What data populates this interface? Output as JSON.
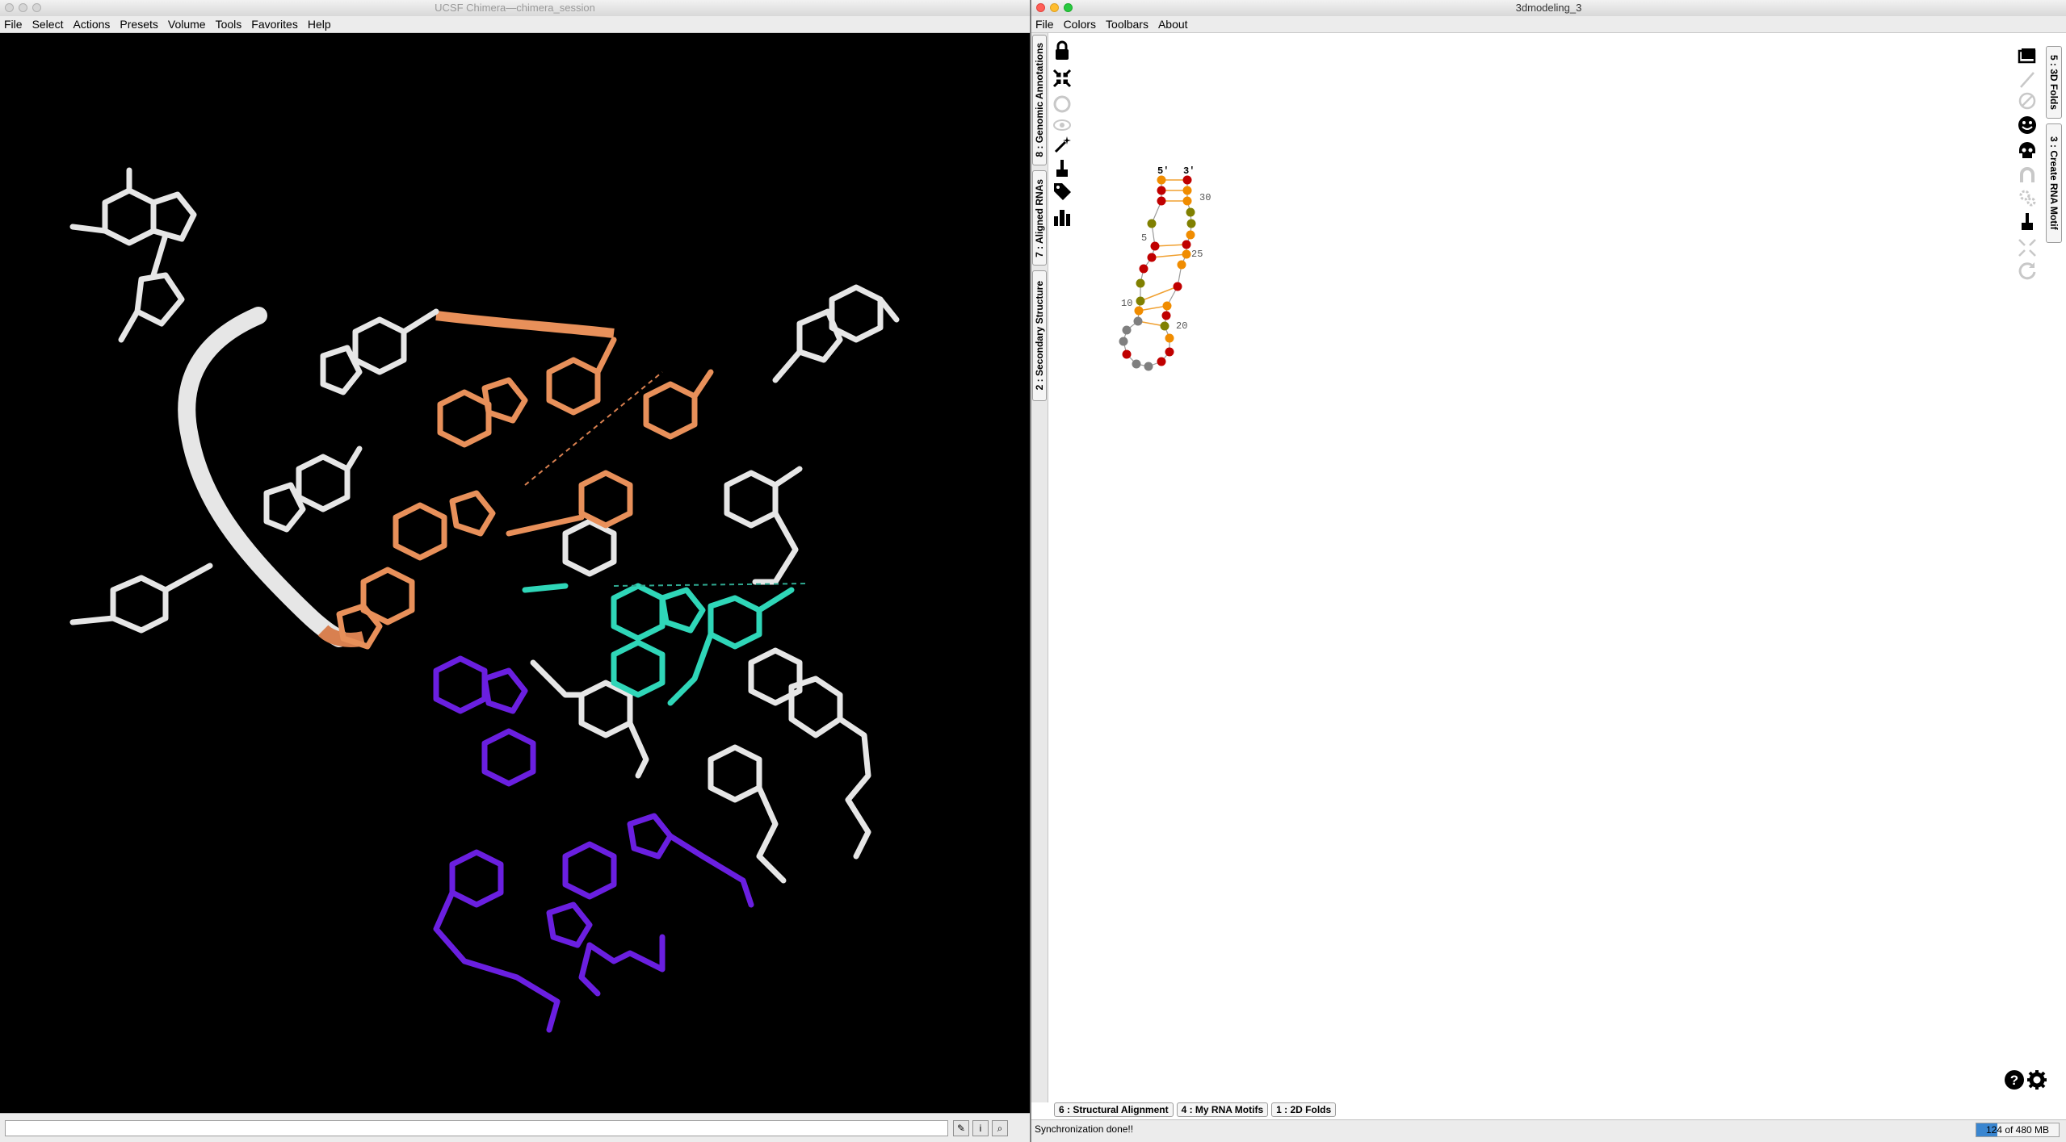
{
  "chimera": {
    "title": "UCSF Chimera—chimera_session",
    "menu": [
      "File",
      "Select",
      "Actions",
      "Presets",
      "Volume",
      "Tools",
      "Favorites",
      "Help"
    ],
    "command_line": {
      "value": ""
    },
    "bottom_buttons": [
      {
        "name": "draw-icon",
        "glyph": "✎"
      },
      {
        "name": "info-icon",
        "glyph": "i"
      },
      {
        "name": "magnifier-icon",
        "glyph": "⌕"
      }
    ]
  },
  "modeler": {
    "title": "3dmodeling_3",
    "menu": [
      "File",
      "Colors",
      "Toolbars",
      "About"
    ],
    "left_tabs": [
      "8 : Genomic Annotations",
      "7 : Aligned RNAs",
      "2 : Secondary Structure"
    ],
    "right_tabs": [
      "5 : 3D Folds",
      "3 : Create RNA Motif"
    ],
    "bottom_tabs": [
      "6 : Structural Alignment",
      "4 : My RNA Motifs",
      "1 : 2D Folds"
    ],
    "status": "Synchronization done!!",
    "memory": {
      "label": "124 of 480 MB used",
      "used_fraction": 0.258
    },
    "colors": {
      "red": "#c00000",
      "orange": "#f08c00",
      "olive": "#808000",
      "gray": "#7f7f7f",
      "pair": "#f0a030"
    },
    "structure": {
      "five_prime": "5'",
      "three_prime": "3'",
      "numbers": [
        "5",
        "10",
        "20",
        "25",
        "30"
      ]
    }
  }
}
